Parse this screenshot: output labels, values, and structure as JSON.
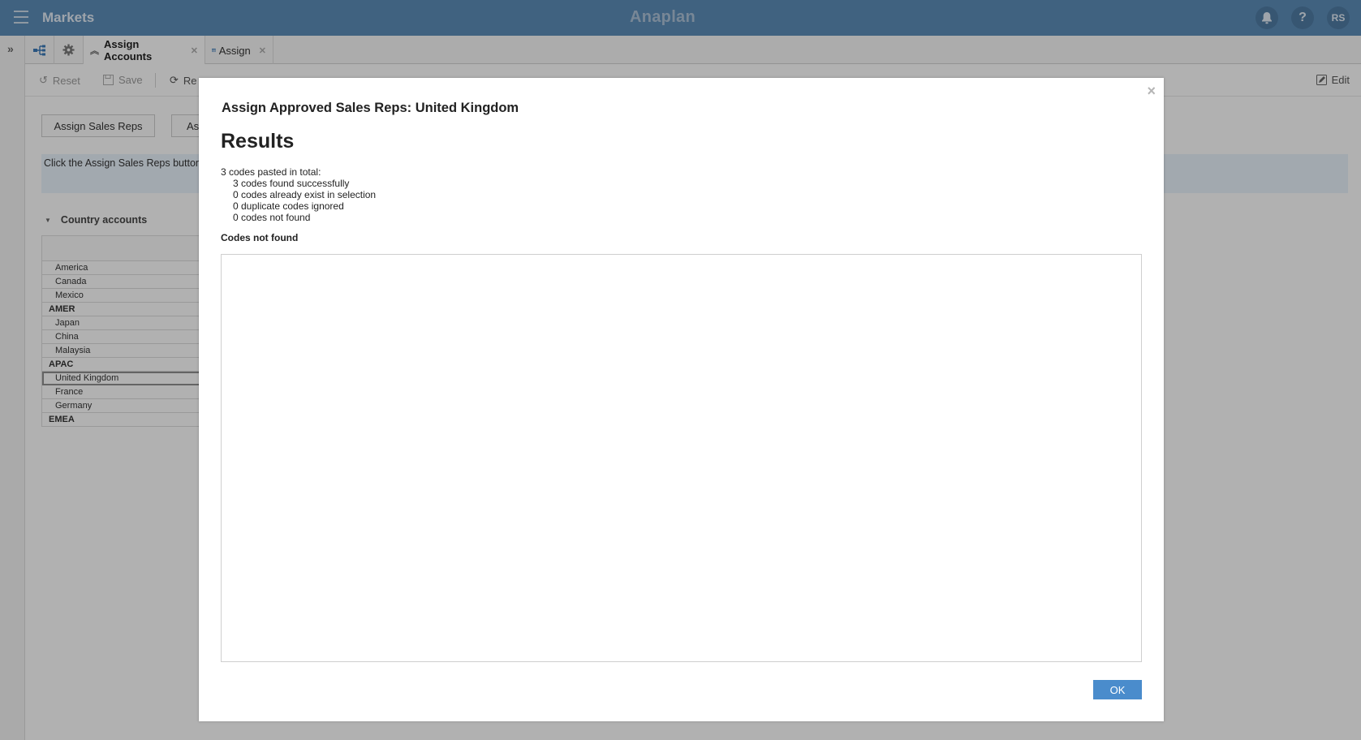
{
  "header": {
    "app_title": "Markets",
    "brand": "/\\naplan",
    "brand_display": "Anaplan",
    "help_label": "?",
    "avatar_initials": "RS"
  },
  "tabs": [
    {
      "label": "Assign Accounts",
      "icon": "chevron-up-double-icon",
      "active": true
    },
    {
      "label": "Assign",
      "icon": "grid-icon",
      "active": false
    }
  ],
  "toolbar": {
    "reset_label": "Reset",
    "save_label": "Save",
    "refresh_label": "Re",
    "edit_label": "Edit"
  },
  "page": {
    "buttons": [
      "Assign Sales Reps",
      "As"
    ],
    "info_text": "Click the Assign Sales Reps button",
    "section_title": "Country accounts",
    "rows": [
      {
        "label": "America",
        "group": false
      },
      {
        "label": "Canada",
        "group": false
      },
      {
        "label": "Mexico",
        "group": false
      },
      {
        "label": "AMER",
        "group": true
      },
      {
        "label": "Japan",
        "group": false
      },
      {
        "label": "China",
        "group": false
      },
      {
        "label": "Malaysia",
        "group": false
      },
      {
        "label": "APAC",
        "group": true
      },
      {
        "label": "United Kingdom",
        "group": false,
        "selected": true
      },
      {
        "label": "France",
        "group": false
      },
      {
        "label": "Germany",
        "group": false
      },
      {
        "label": "EMEA",
        "group": true
      }
    ]
  },
  "modal": {
    "title": "Assign Approved Sales Reps: United Kingdom",
    "results_heading": "Results",
    "summary_total": "3 codes pasted in total:",
    "summary_lines": [
      "3 codes found successfully",
      "0 codes already exist in selection",
      "0 duplicate codes ignored",
      "0 codes not found"
    ],
    "codes_not_found_label": "Codes not found",
    "codes_not_found_value": "",
    "ok_label": "OK",
    "close_symbol": "×"
  },
  "colors": {
    "header_bg": "#5b8bb5",
    "ok_button": "#4a8ccc",
    "info_box": "#e5eef7"
  }
}
